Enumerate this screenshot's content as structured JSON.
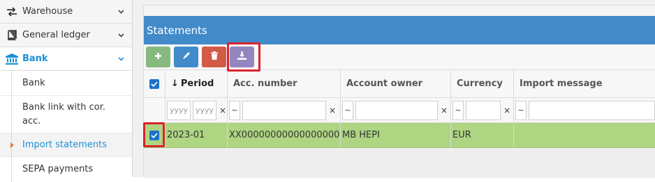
{
  "sidebar": {
    "items": [
      {
        "label": "Warehouse",
        "icon": "arrows-exchange-icon"
      },
      {
        "label": "General ledger",
        "icon": "book-icon"
      },
      {
        "label": "Bank",
        "icon": "bank-building-icon"
      }
    ],
    "sub_items": [
      {
        "label": "Bank"
      },
      {
        "label": "Bank link with cor. acc."
      },
      {
        "label": "Import statements"
      },
      {
        "label": "SEPA payments"
      }
    ]
  },
  "panel": {
    "title": "Statements"
  },
  "toolbar": {
    "buttons": [
      "plus-icon",
      "pencil-icon",
      "trash-icon",
      "download-icon"
    ]
  },
  "grid": {
    "columns": [
      "Period",
      "Acc. number",
      "Account owner",
      "Currency",
      "Import message"
    ],
    "sort_indicator": "↓",
    "filters": {
      "period_from_placeholder": "yyyy",
      "period_to_placeholder": "yyyy",
      "clear": "×",
      "op": "~"
    },
    "rows": [
      {
        "period": "2023-01",
        "acc_number": "XX000000000000000000",
        "owner": "MB HEPI",
        "currency": "EUR",
        "message": ""
      }
    ]
  },
  "colors": {
    "accent": "#1a8fd6",
    "header": "#428bca",
    "selected_row": "#aed581",
    "highlight": "#d9232e"
  }
}
